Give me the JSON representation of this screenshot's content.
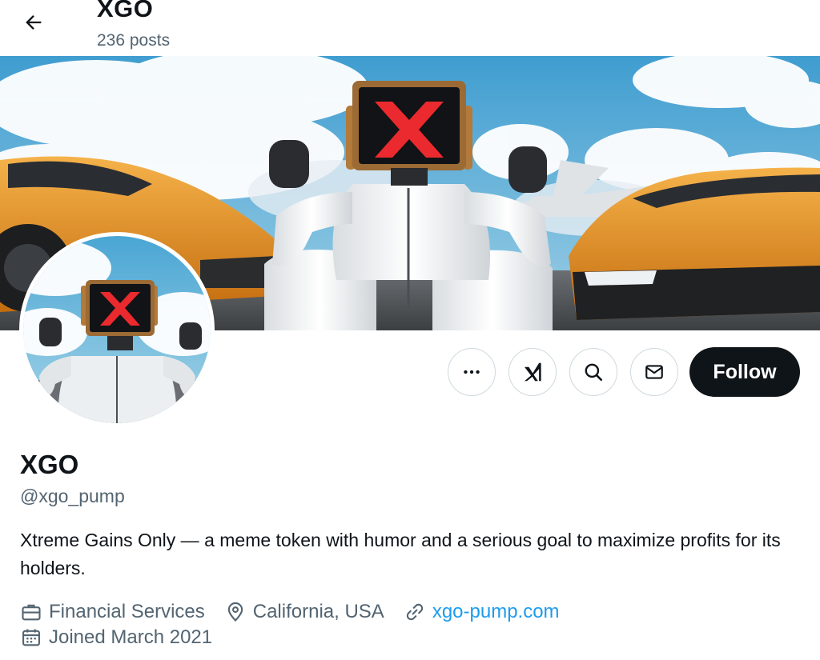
{
  "header": {
    "title": "XGO",
    "posts_count": "236 posts"
  },
  "profile": {
    "display_name": "XGO",
    "handle": "@xgo_pump",
    "bio": "Xtreme Gains Only — a meme token with humor and a serious goal to maximize profits for its holders.",
    "category": "Financial Services",
    "location": "California, USA",
    "website": "xgo-pump.com",
    "joined": "Joined March 2021"
  },
  "actions": {
    "more_icon": "more-horizontal-icon",
    "grok_icon": "grok-icon",
    "search_icon": "search-icon",
    "message_icon": "envelope-icon",
    "follow_label": "Follow"
  },
  "colors": {
    "accent_link": "#1d9bf0",
    "follow_bg": "#0f1419",
    "secondary_text": "#536471",
    "button_border": "#cfd9de"
  }
}
